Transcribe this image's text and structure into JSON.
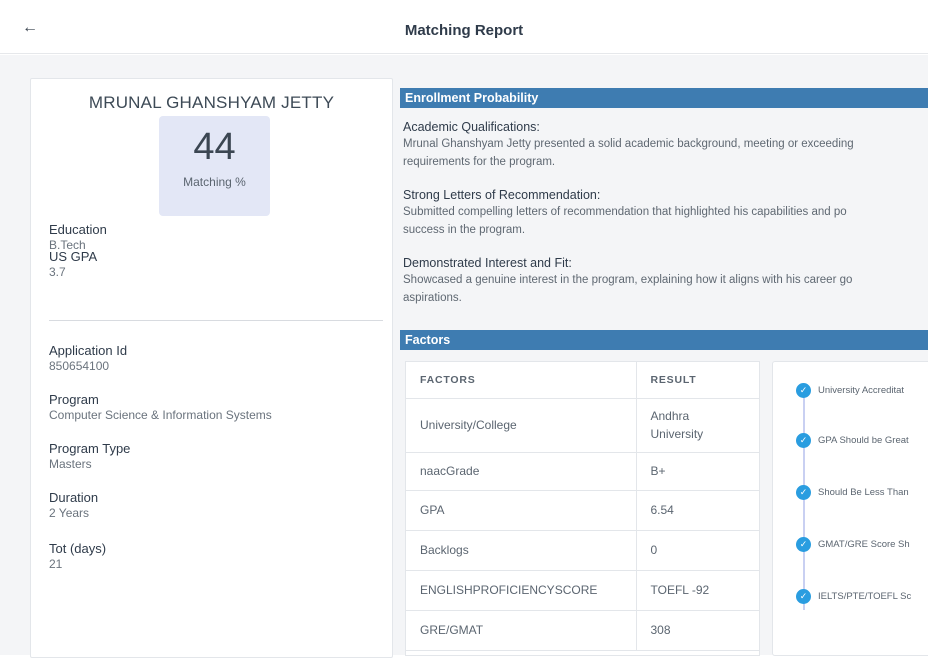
{
  "header": {
    "back_icon": "arrow-left-icon",
    "title": "Matching Report"
  },
  "profile": {
    "name": "MRUNAL GHANSHYAM JETTY",
    "matching_value": "44",
    "matching_label": "Matching %",
    "education_label": "Education",
    "education_value": "B.Tech",
    "gpa_label": "US GPA",
    "gpa_value": "3.7",
    "application_label": "Application Id",
    "application_value": "850654100",
    "program_label": "Program",
    "program_value": "Computer Science & Information Systems",
    "program_type_label": "Program Type",
    "program_type_value": "Masters",
    "duration_label": "Duration",
    "duration_value": "2 Years",
    "tot_label": "Tot (days)",
    "tot_value": "21"
  },
  "enrollment": {
    "heading": "Enrollment Probability",
    "reasons": [
      {
        "title": "Academic Qualifications:",
        "line1": "Mrunal Ghanshyam Jetty presented a solid academic background, meeting or exceeding",
        "line2": "requirements for the program."
      },
      {
        "title": "Strong Letters of Recommendation:",
        "line1": "Submitted compelling letters of recommendation that highlighted his capabilities and po",
        "line2": "success in the program."
      },
      {
        "title": "Demonstrated Interest and Fit:",
        "line1": "Showcased a genuine interest in the program, explaining how it aligns with his career go",
        "line2": "aspirations."
      }
    ]
  },
  "factors": {
    "heading": "Factors",
    "col_factors": "FACTORS",
    "col_result": "RESULT",
    "rows": [
      {
        "factor": "University/College",
        "result_line1": "Andhra",
        "result_line2": "University"
      },
      {
        "factor": "naacGrade",
        "result_line1": "B+",
        "result_line2": ""
      },
      {
        "factor": "GPA",
        "result_line1": "6.54",
        "result_line2": ""
      },
      {
        "factor": "Backlogs",
        "result_line1": "0",
        "result_line2": ""
      },
      {
        "factor": "ENGLISHPROFICIENCYSCORE",
        "result_line1": "TOEFL -92",
        "result_line2": ""
      },
      {
        "factor": "GRE/GMAT",
        "result_line1": "308",
        "result_line2": ""
      }
    ],
    "checklist": [
      {
        "icon": "check-circle-icon",
        "text": "University Accreditat"
      },
      {
        "icon": "check-circle-icon",
        "text": "GPA Should be Great"
      },
      {
        "icon": "check-circle-icon",
        "text": "Should Be Less Than"
      },
      {
        "icon": "check-circle-icon",
        "text": "GMAT/GRE Score Sh"
      },
      {
        "icon": "check-circle-icon",
        "text": "IELTS/PTE/TOEFL Sc"
      }
    ]
  }
}
